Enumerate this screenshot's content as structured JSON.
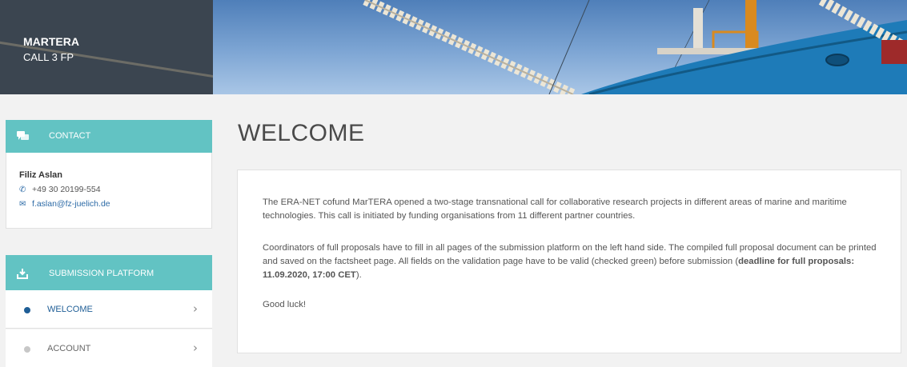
{
  "header": {
    "brand_title": "MARTERA",
    "brand_subtitle": "CALL 3 FP"
  },
  "contact": {
    "header_label": "CONTACT",
    "name": "Filiz Aslan",
    "phone": "+49 30 20199-554",
    "email": "f.aslan@fz-juelich.de"
  },
  "submission": {
    "header_label": "SUBMISSION PLATFORM",
    "items": [
      {
        "label": "WELCOME",
        "active": true,
        "dot_color": "#1f5e96",
        "text_color": "#1f5e96"
      },
      {
        "label": "ACCOUNT",
        "active": false,
        "dot_color": "#c7c7c7",
        "text_color": "#666666"
      }
    ]
  },
  "main": {
    "title": "WELCOME",
    "paragraph1": "The ERA-NET cofund MarTERA opened a two-stage transnational call for collaborative research projects in different areas of marine and maritime technologies.  This call is initiated by funding organisations from 11 different partner countries.",
    "paragraph2_text": "Coordinators of full proposals have to fill in all pages of the submission platform on the left hand side. The compiled full proposal document can be printed and saved on the factsheet page. All fields on the validation page have to be valid (checked green) before submission (",
    "paragraph2_bold": "deadline for full proposals: 11.09.2020, 17:00 CET",
    "paragraph2_end": ").",
    "paragraph3": "Good luck!"
  },
  "colors": {
    "accent_teal": "#62c3c3",
    "brand_dark": "#3b4550",
    "link_blue": "#2c6aa6"
  },
  "icons": {
    "contact": "chat-bubbles-icon",
    "submission": "upload-tray-icon",
    "phone": "phone-icon",
    "email": "envelope-icon",
    "chevron": "chevron-right-icon"
  }
}
